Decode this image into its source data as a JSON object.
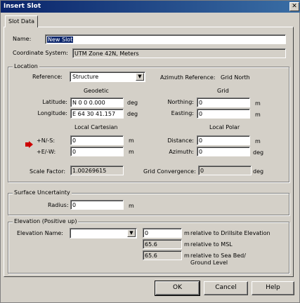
{
  "window": {
    "title": "Insert Slot",
    "close_glyph": "✕"
  },
  "tab": {
    "label": "Slot Data"
  },
  "name": {
    "label": "Name:",
    "value": "New Slot"
  },
  "coordinate_system": {
    "label": "Coordinate System:",
    "value": "UTM Zone 42N, Meters"
  },
  "location": {
    "group_title": "Location",
    "reference_label": "Reference:",
    "reference_value": "Structure",
    "azimuth_reference_label": "Azimuth Reference:",
    "azimuth_reference_value": "Grid North",
    "geodetic_header": "Geodetic",
    "grid_header": "Grid",
    "latitude_label": "Latitude:",
    "latitude_value": "N 0 0 0.000",
    "longitude_label": "Longitude:",
    "longitude_value": "E 64 30 41.157",
    "deg_unit": "deg",
    "northing_label": "Northing:",
    "northing_value": "0",
    "easting_label": "Easting:",
    "easting_value": "0",
    "m_unit": "m",
    "local_cartesian_header": "Local Cartesian",
    "local_polar_header": "Local Polar",
    "ns_label": "+N/-S:",
    "ns_value": "0",
    "ew_label": "+E/-W:",
    "ew_value": "0",
    "distance_label": "Distance:",
    "distance_value": "0",
    "azimuth_label": "Azimuth:",
    "azimuth_value": "0",
    "scale_factor_label": "Scale Factor:",
    "scale_factor_value": "1.00269615",
    "grid_convergence_label": "Grid Convergence:",
    "grid_convergence_value": "0"
  },
  "surface_uncertainty": {
    "group_title": "Surface Uncertainty",
    "radius_label": "Radius:",
    "radius_value": "0",
    "m_unit": "m"
  },
  "elevation": {
    "group_title": "Elevation (Positive up)",
    "name_label": "Elevation Name:",
    "name_value": "",
    "m_unit": "m",
    "drillsite_value": "0",
    "drillsite_label": "relative to Drillsite Elevation",
    "msl_value": "65.6",
    "msl_label": "relative to MSL",
    "seabed_value": "65.6",
    "seabed_label": "relative to Sea Bed/",
    "seabed_label2": "Ground Level"
  },
  "buttons": {
    "ok": "OK",
    "cancel": "Cancel",
    "help": "Help"
  },
  "colors": {
    "marker": "#cc0000",
    "titlebar": "#0a246a"
  }
}
